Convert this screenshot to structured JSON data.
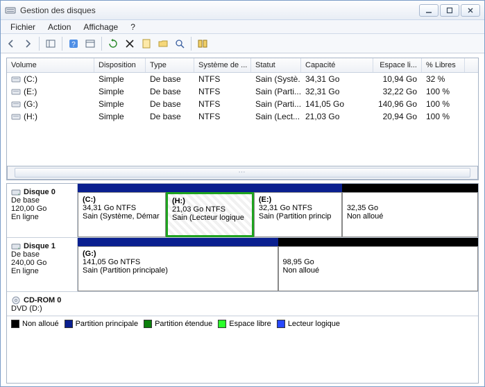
{
  "window": {
    "title": "Gestion des disques"
  },
  "menu": {
    "file": "Fichier",
    "action": "Action",
    "view": "Affichage",
    "help": "?"
  },
  "columns": {
    "volume": "Volume",
    "disposition": "Disposition",
    "type": "Type",
    "fs": "Système de ...",
    "status": "Statut",
    "capacity": "Capacité",
    "free": "Espace li...",
    "pct": "% Libres"
  },
  "volumes": [
    {
      "letter": "(C:)",
      "disposition": "Simple",
      "type": "De base",
      "fs": "NTFS",
      "status": "Sain (Systè...",
      "capacity": "34,31 Go",
      "free": "10,94 Go",
      "pct": "32 %"
    },
    {
      "letter": "(E:)",
      "disposition": "Simple",
      "type": "De base",
      "fs": "NTFS",
      "status": "Sain (Parti...",
      "capacity": "32,31 Go",
      "free": "32,22 Go",
      "pct": "100 %"
    },
    {
      "letter": "(G:)",
      "disposition": "Simple",
      "type": "De base",
      "fs": "NTFS",
      "status": "Sain (Parti...",
      "capacity": "141,05 Go",
      "free": "140,96 Go",
      "pct": "100 %"
    },
    {
      "letter": "(H:)",
      "disposition": "Simple",
      "type": "De base",
      "fs": "NTFS",
      "status": "Sain (Lect...",
      "capacity": "21,03 Go",
      "free": "20,94 Go",
      "pct": "100 %"
    }
  ],
  "disks": [
    {
      "name": "Disque 0",
      "type": "De base",
      "size": "120,00 Go",
      "state": "En ligne",
      "partitions": [
        {
          "letter": "(C:)",
          "line1": "34,31 Go NTFS",
          "line2": "Sain (Système, Démar",
          "barColor": "#0a1f8f",
          "widthPct": 22,
          "selected": false
        },
        {
          "letter": "(H:)",
          "line1": "21,03 Go NTFS",
          "line2": "Sain (Lecteur logique",
          "barColor": "#0a1f8f",
          "widthPct": 22,
          "selected": true
        },
        {
          "letter": "(E:)",
          "line1": "32,31 Go NTFS",
          "line2": "Sain (Partition princip",
          "barColor": "#0a1f8f",
          "widthPct": 22,
          "selected": false
        },
        {
          "letter": "",
          "line1": "32,35 Go",
          "line2": "Non alloué",
          "barColor": "#000000",
          "widthPct": 34,
          "selected": false
        }
      ]
    },
    {
      "name": "Disque 1",
      "type": "De base",
      "size": "240,00 Go",
      "state": "En ligne",
      "partitions": [
        {
          "letter": "(G:)",
          "line1": "141,05 Go NTFS",
          "line2": "Sain (Partition principale)",
          "barColor": "#0a1f8f",
          "widthPct": 50,
          "selected": false
        },
        {
          "letter": "",
          "line1": "98,95 Go",
          "line2": "Non alloué",
          "barColor": "#000000",
          "widthPct": 50,
          "selected": false
        }
      ]
    }
  ],
  "cdrom": {
    "name": "CD-ROM 0",
    "line": "DVD (D:)"
  },
  "legend": {
    "unalloc": "Non alloué",
    "primary": "Partition principale",
    "extended": "Partition étendue",
    "free": "Espace libre",
    "logical": "Lecteur logique"
  },
  "colors": {
    "unalloc": "#000000",
    "primary": "#0a1f8f",
    "extended": "#0b7f0b",
    "free": "#2bff2b",
    "logical": "#2848ff"
  }
}
